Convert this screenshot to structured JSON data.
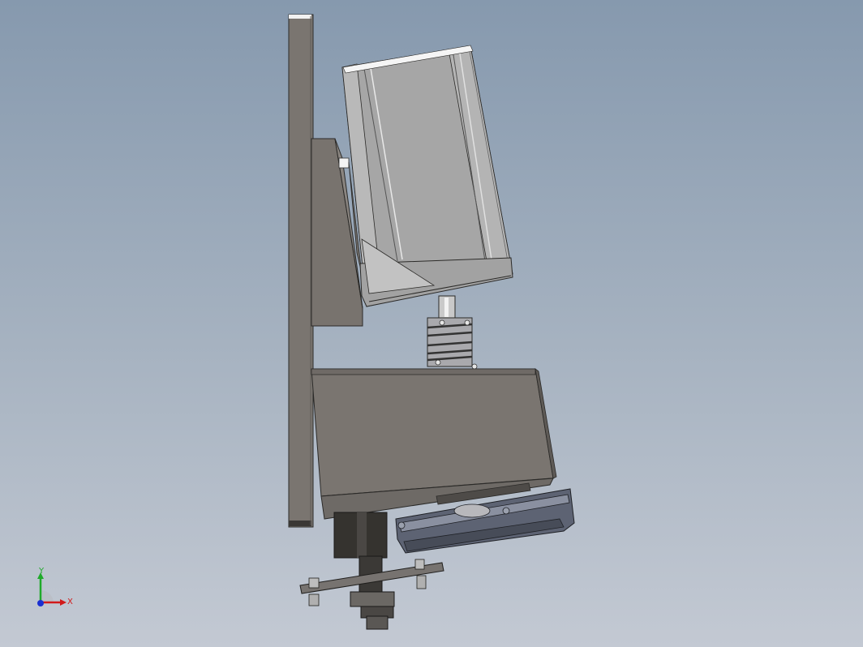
{
  "viewport": {
    "background_top": "#8699ae",
    "background_bottom": "#c3c9d3"
  },
  "model": {
    "parts": [
      "mounting-plate",
      "angle-bracket",
      "stepper-motor",
      "motor-shaft",
      "flexible-coupling",
      "gearbox-housing",
      "gearbox-flange",
      "output-shaft",
      "bearing-clamp",
      "bolt-bar"
    ],
    "colors": {
      "plate": "#7a7570",
      "motor": "#a6a6a6",
      "clamp": "#5d6373",
      "dark": "#35332f"
    }
  },
  "triad": {
    "x_label": "X",
    "y_label": "Y",
    "x_color": "#d11a1a",
    "y_color": "#1faa2a",
    "z_color": "#1a2fd1"
  }
}
